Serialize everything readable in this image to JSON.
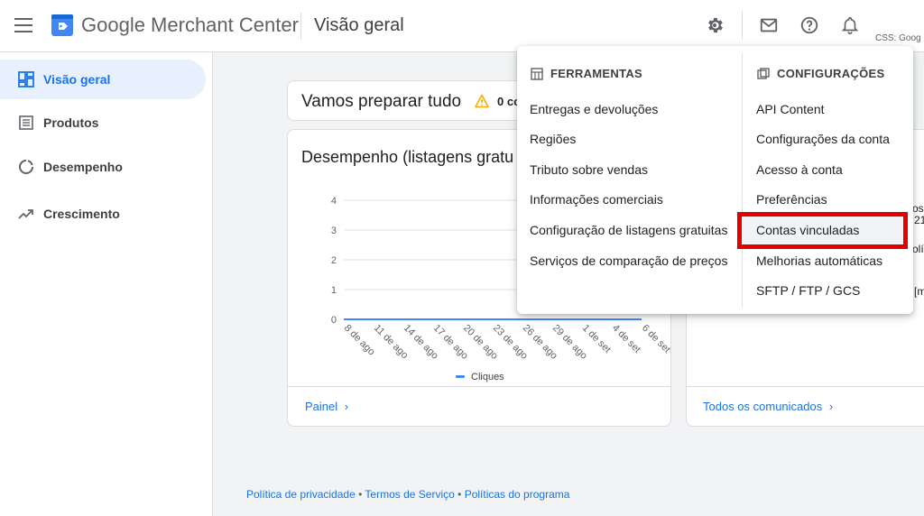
{
  "header": {
    "brand": "Google Merchant Center",
    "page_title": "Visão geral",
    "css_label": "CSS: Goog",
    "icons": [
      "gear-icon",
      "mail-icon",
      "help-icon",
      "bell-icon"
    ]
  },
  "sidebar": {
    "items": [
      {
        "label": "Visão geral",
        "icon": "dashboard-icon",
        "active": true
      },
      {
        "label": "Produtos",
        "icon": "list-icon",
        "active": false
      },
      {
        "label": "Desempenho",
        "icon": "donut-icon",
        "active": false
      },
      {
        "label": "Crescimento",
        "icon": "trend-icon",
        "active": false
      }
    ]
  },
  "setup_card": {
    "title": "Vamos preparar tudo",
    "count": "0 co"
  },
  "performance_card": {
    "title": "Desempenho (listagens gratu",
    "link": "Painel"
  },
  "chart_data": {
    "type": "line",
    "categories": [
      "8 de ago",
      "11 de ago",
      "14 de ago",
      "17 de ago",
      "20 de ago",
      "23 de ago",
      "26 de ago",
      "29 de ago",
      "1 de set",
      "4 de set",
      "6 de set"
    ],
    "series": [
      {
        "name": "Cliques",
        "values": [
          0,
          0,
          0,
          0,
          0,
          0,
          0,
          0,
          0,
          0,
          0
        ],
        "color": "#4285f4"
      }
    ],
    "yticks": [
      "0",
      "1",
      "2",
      "3",
      "4"
    ],
    "ylim": [
      0,
      4
    ],
    "grid": true,
    "legend": "bottom"
  },
  "right_card": {
    "link": "Todos os comunicados",
    "fragments": [
      "os",
      "21",
      "olí",
      "[m"
    ]
  },
  "footer": {
    "privacy": "Política de privacidade",
    "terms": "Termos de Serviço",
    "program": "Políticas do programa",
    "separator": "•"
  },
  "dropdown": {
    "tools": {
      "header": "FERRAMENTAS",
      "items": [
        "Entregas e devoluções",
        "Regiões",
        "Tributo sobre vendas",
        "Informações comerciais",
        "Configuração de listagens gratuitas",
        "Serviços de comparação de preços"
      ]
    },
    "settings": {
      "header": "CONFIGURAÇÕES",
      "items": [
        "API Content",
        "Configurações da conta",
        "Acesso à conta",
        "Preferências",
        "Contas vinculadas",
        "Melhorias automáticas",
        "SFTP / FTP / GCS"
      ],
      "highlighted": "Contas vinculadas"
    }
  },
  "colors": {
    "accent": "#1a73e8",
    "highlight": "#e00000",
    "warning": "#f9ab00"
  }
}
